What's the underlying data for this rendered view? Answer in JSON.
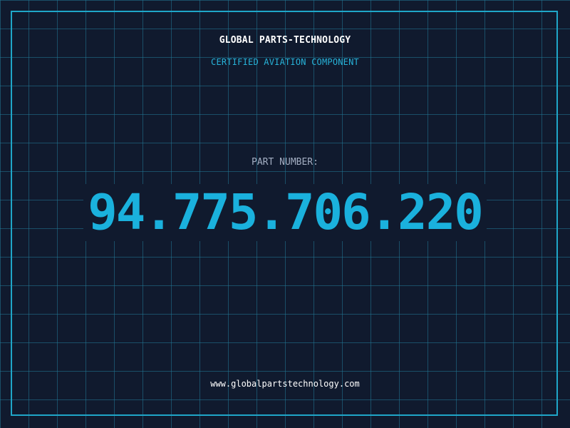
{
  "header": {
    "company": "GLOBAL PARTS-TECHNOLOGY",
    "subtitle": "CERTIFIED AVIATION COMPONENT"
  },
  "part": {
    "label": "PART NUMBER:",
    "number": "94.775.706.220"
  },
  "footer": {
    "url": "www.globalpartstechnology.com"
  },
  "colors": {
    "background": "#101a2e",
    "grid": "#227896",
    "accent": "#1ab1dd",
    "frame": "#1fa6c8"
  }
}
